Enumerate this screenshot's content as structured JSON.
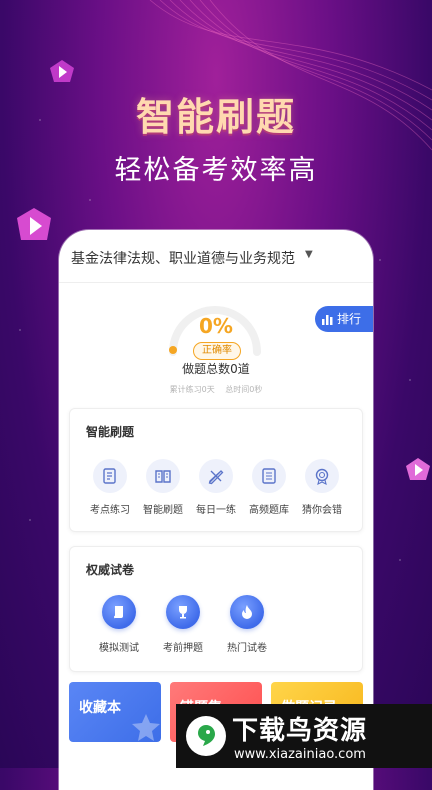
{
  "hero": {
    "headline": "智能刷题",
    "subline": "轻松备考效率高"
  },
  "subject_bar": {
    "text": "基金法律法规、职业道德与业务规范",
    "caret": "▼"
  },
  "progress": {
    "percent_text": "0%",
    "percent_value": 0,
    "accuracy_label": "正确率",
    "total_questions": "做题总数0道",
    "days_practiced": "累计练习0天",
    "total_time": "总时间0秒"
  },
  "rank_button": {
    "label": "排行"
  },
  "smart_practice": {
    "title": "智能刷题",
    "items": [
      {
        "label": "考点练习",
        "icon": "edit-note-icon"
      },
      {
        "label": "智能刷题",
        "icon": "book-icon"
      },
      {
        "label": "每日一练",
        "icon": "pencil-ruler-icon"
      },
      {
        "label": "高频题库",
        "icon": "document-list-icon"
      },
      {
        "label": "猜你会错",
        "icon": "badge-icon"
      }
    ]
  },
  "authority_papers": {
    "title": "权威试卷",
    "items": [
      {
        "label": "模拟测试",
        "icon": "scroll-icon"
      },
      {
        "label": "考前押题",
        "icon": "trophy-icon"
      },
      {
        "label": "热门试卷",
        "icon": "flame-icon"
      }
    ]
  },
  "bottom_cards": [
    {
      "label": "收藏本",
      "color": "#4a78f0"
    },
    {
      "label": "错题集",
      "color": "#ff5a5a"
    },
    {
      "label": "做题记录",
      "color": "#f7c42a"
    }
  ],
  "watermark": {
    "title": "下载鸟资源",
    "url": "www.xiazainiao.com"
  },
  "colors": {
    "accent_blue": "#3d6ee8",
    "accuracy_orange": "#f5a623",
    "background_purple": "#6a0f86"
  }
}
